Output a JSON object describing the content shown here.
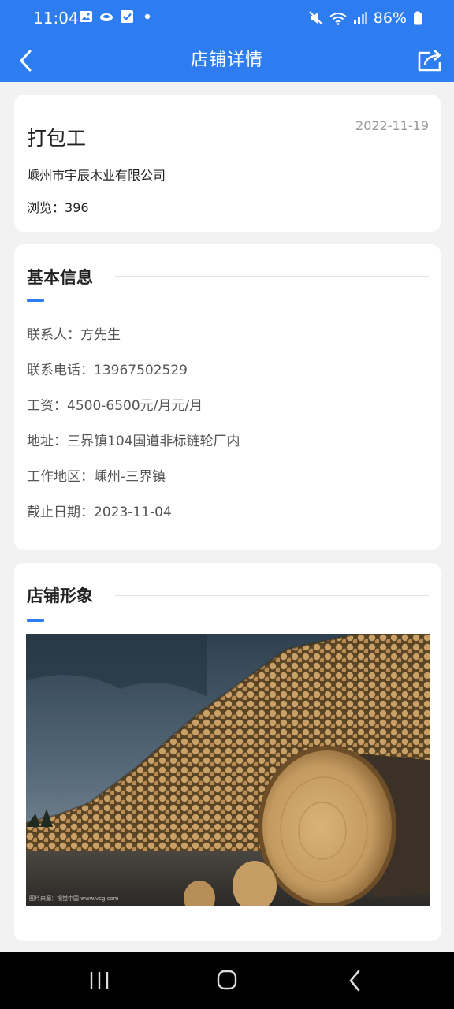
{
  "status_bar": {
    "time": "11:04",
    "battery": "86%"
  },
  "header": {
    "title": "店铺详情",
    "back_icon": "chevron-left-icon",
    "share_icon": "share-icon"
  },
  "job": {
    "title": "打包工",
    "date": "2022-11-19",
    "company": "嵊州市宇辰木业有限公司",
    "views_label": "浏览：",
    "views_value": "396"
  },
  "basic_info": {
    "section_title": "基本信息",
    "rows": [
      {
        "label": "联系人：",
        "value": "方先生"
      },
      {
        "label": "联系电话：",
        "value": "13967502529"
      },
      {
        "label": "工资：",
        "value": "4500-6500元/月元/月"
      },
      {
        "label": "地址：",
        "value": "三界镇104国道非标链轮厂内"
      },
      {
        "label": "工作地区：",
        "value": "嵊州-三界镇"
      },
      {
        "label": "截止日期：",
        "value": "2023-11-04"
      }
    ]
  },
  "store_image": {
    "section_title": "店铺形象",
    "caption": "图片来源：视觉中国 www.vcg.com"
  },
  "colors": {
    "primary": "#2d7cf0",
    "background": "#f2f2f2"
  }
}
